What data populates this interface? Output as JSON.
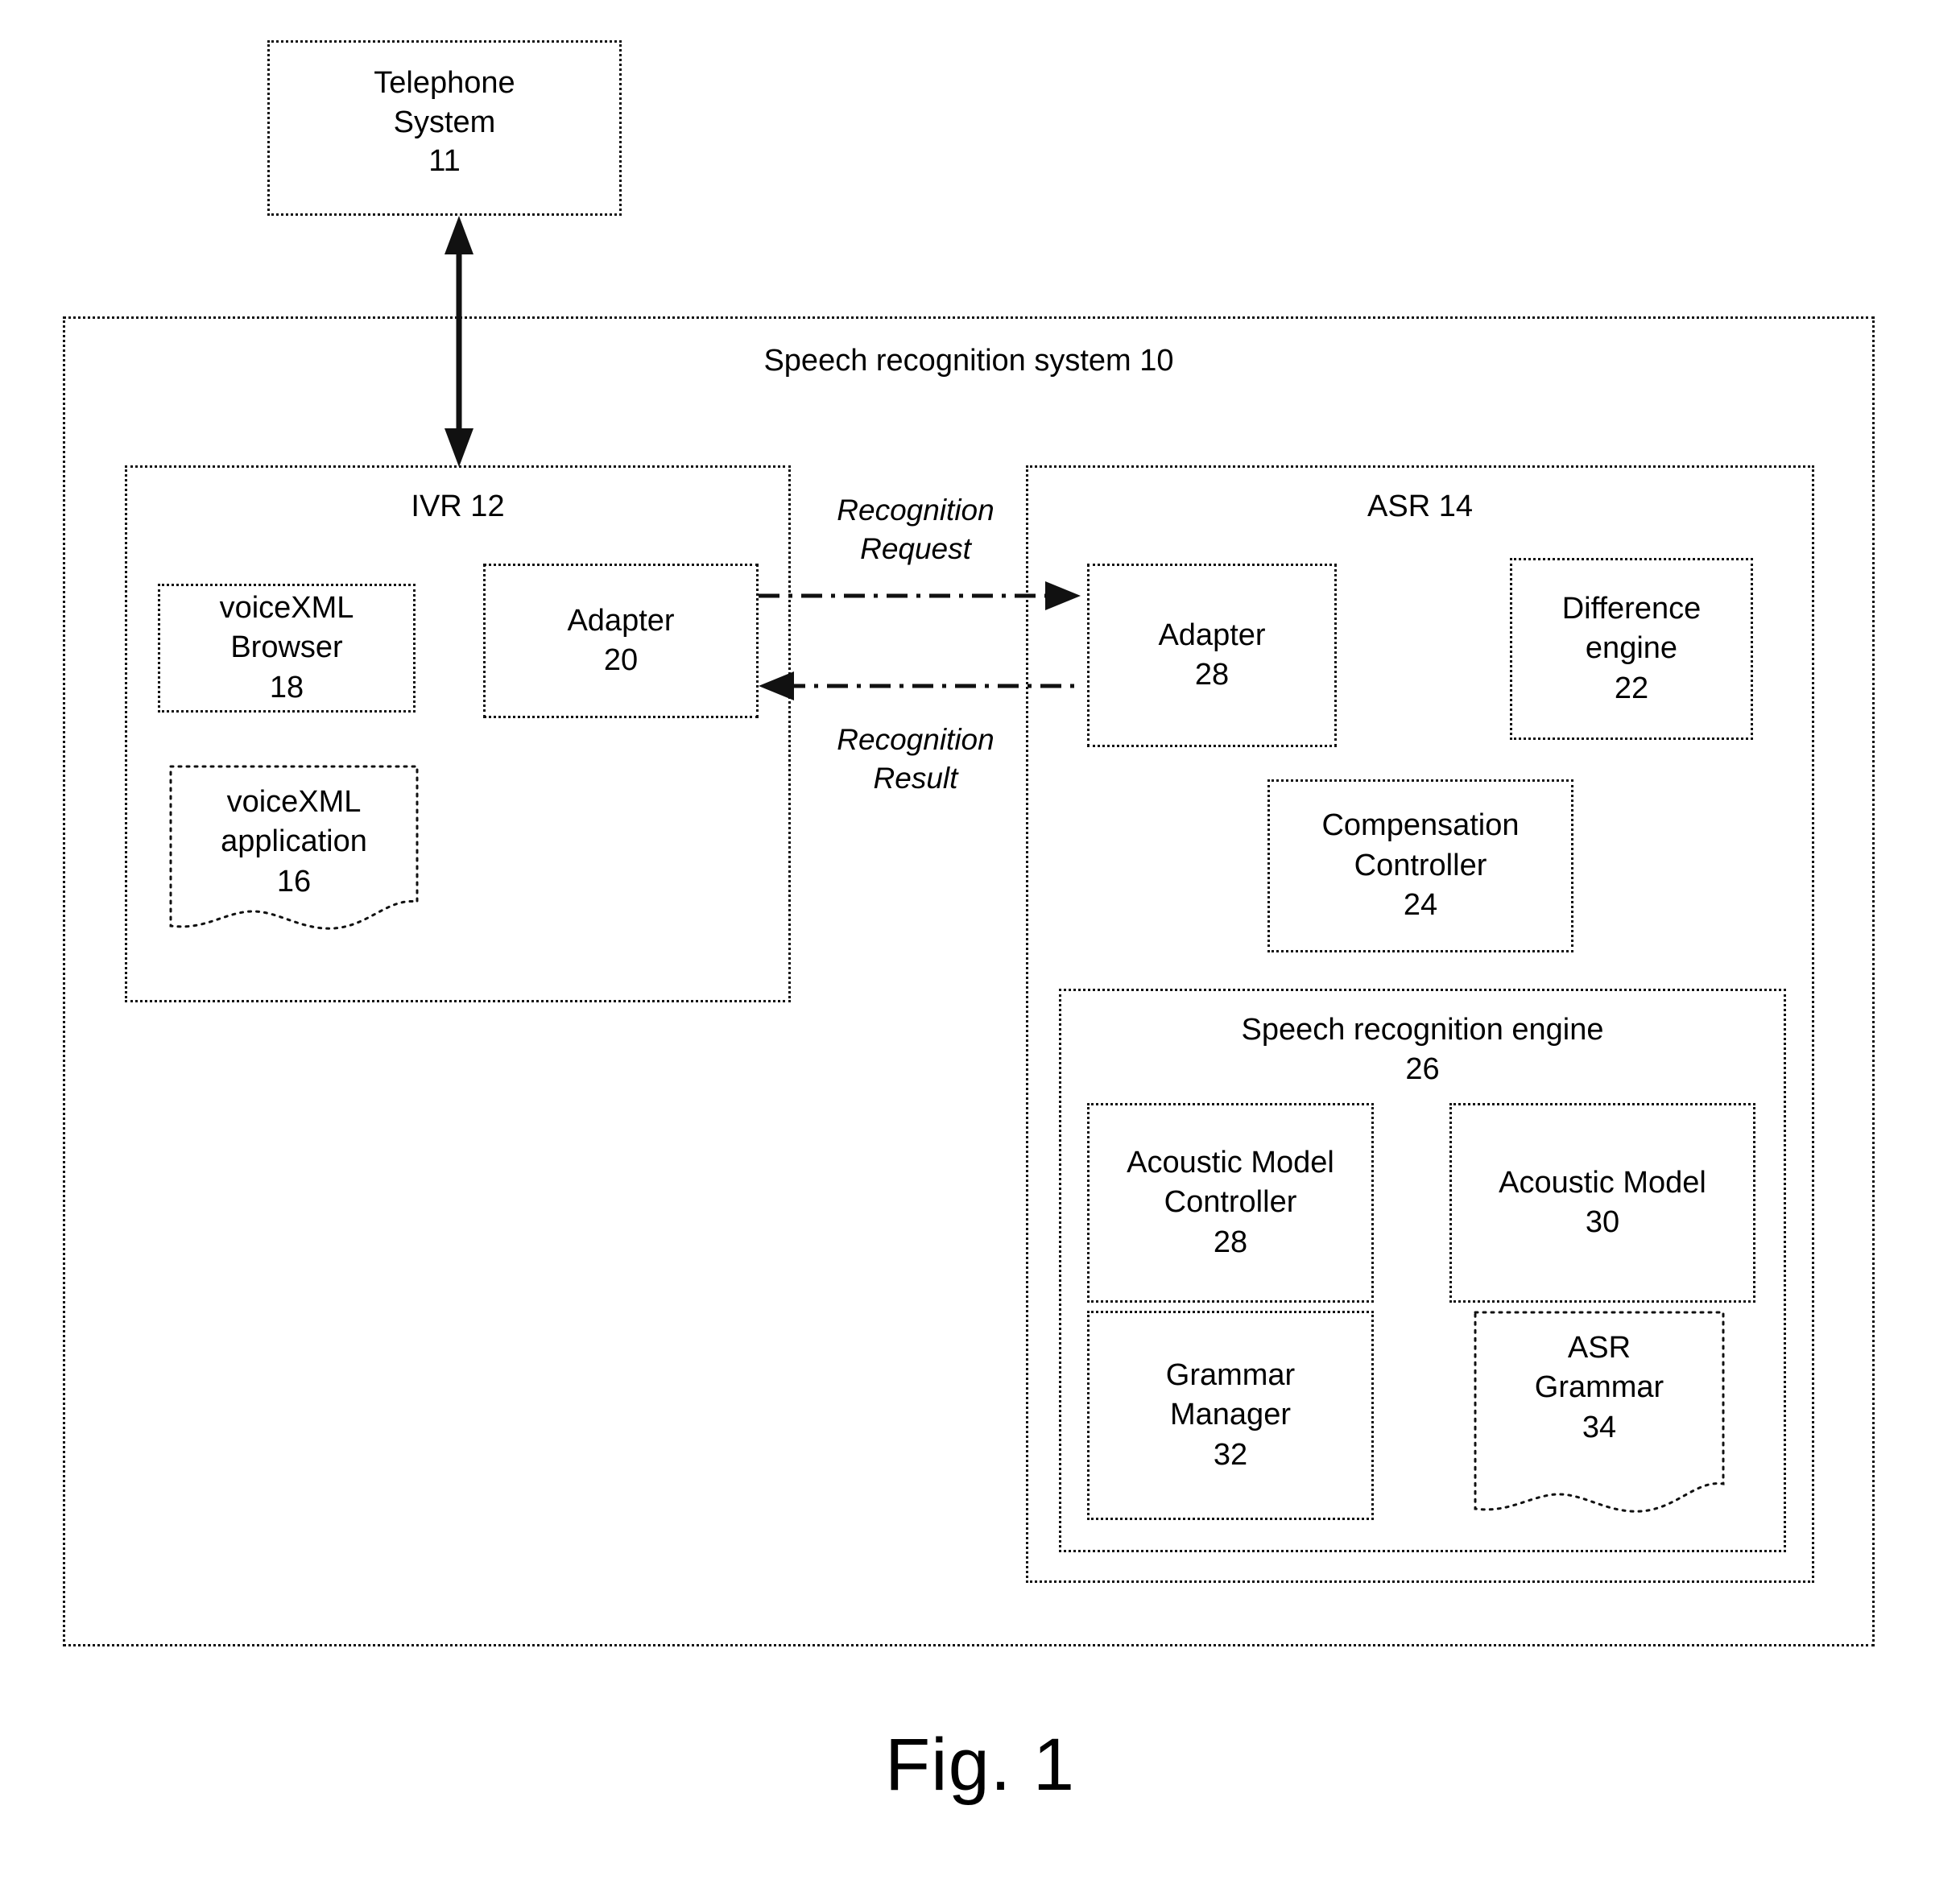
{
  "figure": {
    "caption": "Fig. 1"
  },
  "telephone_system": {
    "label": "Telephone\nSystem\n11"
  },
  "system": {
    "title": "Speech recognition system 10"
  },
  "ivr": {
    "title": "IVR 12",
    "voicexml_browser": "voiceXML\nBrowser\n18",
    "voicexml_application": "voiceXML\napplication\n16",
    "adapter": "Adapter\n20"
  },
  "asr": {
    "title": "ASR 14",
    "adapter": "Adapter\n28",
    "difference_engine": "Difference\nengine\n22",
    "compensation_controller": "Compensation\nController\n24",
    "engine": {
      "title": "Speech recognition engine\n26",
      "acoustic_model_controller": "Acoustic Model\nController\n28",
      "acoustic_model": "Acoustic Model\n30",
      "grammar_manager": "Grammar\nManager\n32",
      "asr_grammar": "ASR\nGrammar\n34"
    }
  },
  "connectors": {
    "telephone_link": "",
    "recognition_request": "Recognition\nRequest",
    "recognition_result": "Recognition\nResult"
  },
  "colors": {
    "ink": "#111111",
    "paper": "#ffffff"
  }
}
